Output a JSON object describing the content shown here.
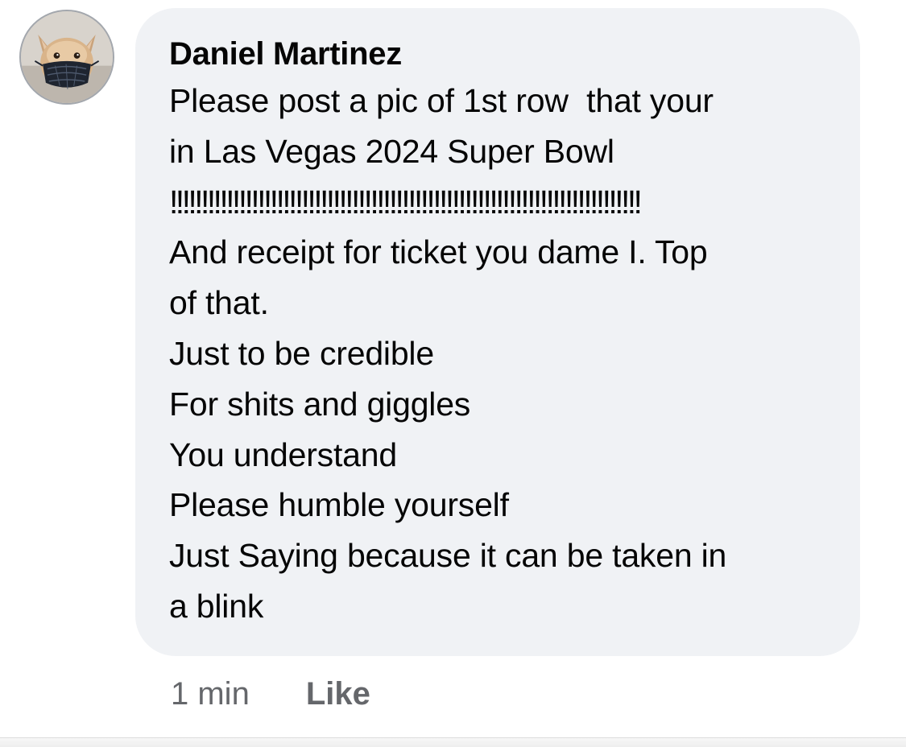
{
  "comment": {
    "author": "Daniel Martinez",
    "lines": [
      "Please post a pic of 1st row  that your",
      "in Las Vegas 2024 Super Bowl",
      "!!!!!!!!!!!!!!!!!!!!!!!!!!!!!!!!!!!!!!!!!!!!!!!!!!!!!!!!!!!!!!!!!!!!!!!!!!!",
      "And receipt for ticket you dame I. Top",
      "of that.",
      "Just to be credible",
      "For shits and giggles",
      "You understand",
      "Please humble yourself",
      "Just Saying because it can be taken in",
      "a blink"
    ],
    "timestamp": "1 min",
    "like_label": "Like"
  },
  "colors": {
    "bubble_background": "#f0f2f5",
    "text": "#050505",
    "secondary_text": "#65676b"
  },
  "icons": {
    "avatar": "profile-photo-dog-wearing-mask"
  }
}
